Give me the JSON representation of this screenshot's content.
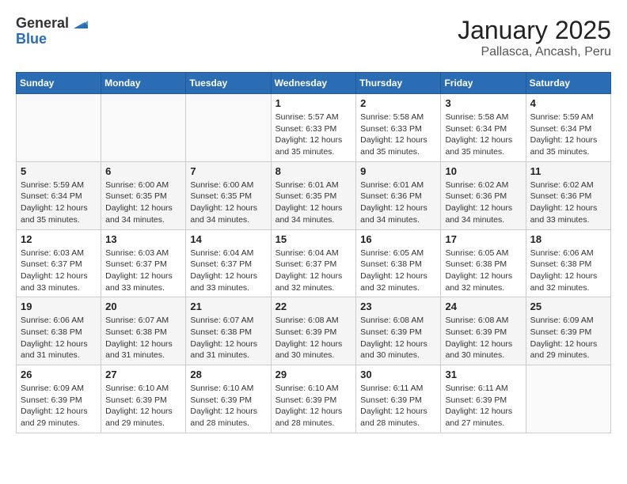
{
  "header": {
    "logo_general": "General",
    "logo_blue": "Blue",
    "month_title": "January 2025",
    "location": "Pallasca, Ancash, Peru"
  },
  "weekdays": [
    "Sunday",
    "Monday",
    "Tuesday",
    "Wednesday",
    "Thursday",
    "Friday",
    "Saturday"
  ],
  "weeks": [
    [
      {
        "day": "",
        "info": ""
      },
      {
        "day": "",
        "info": ""
      },
      {
        "day": "",
        "info": ""
      },
      {
        "day": "1",
        "info": "Sunrise: 5:57 AM\nSunset: 6:33 PM\nDaylight: 12 hours and 35 minutes."
      },
      {
        "day": "2",
        "info": "Sunrise: 5:58 AM\nSunset: 6:33 PM\nDaylight: 12 hours and 35 minutes."
      },
      {
        "day": "3",
        "info": "Sunrise: 5:58 AM\nSunset: 6:34 PM\nDaylight: 12 hours and 35 minutes."
      },
      {
        "day": "4",
        "info": "Sunrise: 5:59 AM\nSunset: 6:34 PM\nDaylight: 12 hours and 35 minutes."
      }
    ],
    [
      {
        "day": "5",
        "info": "Sunrise: 5:59 AM\nSunset: 6:34 PM\nDaylight: 12 hours and 35 minutes."
      },
      {
        "day": "6",
        "info": "Sunrise: 6:00 AM\nSunset: 6:35 PM\nDaylight: 12 hours and 34 minutes."
      },
      {
        "day": "7",
        "info": "Sunrise: 6:00 AM\nSunset: 6:35 PM\nDaylight: 12 hours and 34 minutes."
      },
      {
        "day": "8",
        "info": "Sunrise: 6:01 AM\nSunset: 6:35 PM\nDaylight: 12 hours and 34 minutes."
      },
      {
        "day": "9",
        "info": "Sunrise: 6:01 AM\nSunset: 6:36 PM\nDaylight: 12 hours and 34 minutes."
      },
      {
        "day": "10",
        "info": "Sunrise: 6:02 AM\nSunset: 6:36 PM\nDaylight: 12 hours and 34 minutes."
      },
      {
        "day": "11",
        "info": "Sunrise: 6:02 AM\nSunset: 6:36 PM\nDaylight: 12 hours and 33 minutes."
      }
    ],
    [
      {
        "day": "12",
        "info": "Sunrise: 6:03 AM\nSunset: 6:37 PM\nDaylight: 12 hours and 33 minutes."
      },
      {
        "day": "13",
        "info": "Sunrise: 6:03 AM\nSunset: 6:37 PM\nDaylight: 12 hours and 33 minutes."
      },
      {
        "day": "14",
        "info": "Sunrise: 6:04 AM\nSunset: 6:37 PM\nDaylight: 12 hours and 33 minutes."
      },
      {
        "day": "15",
        "info": "Sunrise: 6:04 AM\nSunset: 6:37 PM\nDaylight: 12 hours and 32 minutes."
      },
      {
        "day": "16",
        "info": "Sunrise: 6:05 AM\nSunset: 6:38 PM\nDaylight: 12 hours and 32 minutes."
      },
      {
        "day": "17",
        "info": "Sunrise: 6:05 AM\nSunset: 6:38 PM\nDaylight: 12 hours and 32 minutes."
      },
      {
        "day": "18",
        "info": "Sunrise: 6:06 AM\nSunset: 6:38 PM\nDaylight: 12 hours and 32 minutes."
      }
    ],
    [
      {
        "day": "19",
        "info": "Sunrise: 6:06 AM\nSunset: 6:38 PM\nDaylight: 12 hours and 31 minutes."
      },
      {
        "day": "20",
        "info": "Sunrise: 6:07 AM\nSunset: 6:38 PM\nDaylight: 12 hours and 31 minutes."
      },
      {
        "day": "21",
        "info": "Sunrise: 6:07 AM\nSunset: 6:38 PM\nDaylight: 12 hours and 31 minutes."
      },
      {
        "day": "22",
        "info": "Sunrise: 6:08 AM\nSunset: 6:39 PM\nDaylight: 12 hours and 30 minutes."
      },
      {
        "day": "23",
        "info": "Sunrise: 6:08 AM\nSunset: 6:39 PM\nDaylight: 12 hours and 30 minutes."
      },
      {
        "day": "24",
        "info": "Sunrise: 6:08 AM\nSunset: 6:39 PM\nDaylight: 12 hours and 30 minutes."
      },
      {
        "day": "25",
        "info": "Sunrise: 6:09 AM\nSunset: 6:39 PM\nDaylight: 12 hours and 29 minutes."
      }
    ],
    [
      {
        "day": "26",
        "info": "Sunrise: 6:09 AM\nSunset: 6:39 PM\nDaylight: 12 hours and 29 minutes."
      },
      {
        "day": "27",
        "info": "Sunrise: 6:10 AM\nSunset: 6:39 PM\nDaylight: 12 hours and 29 minutes."
      },
      {
        "day": "28",
        "info": "Sunrise: 6:10 AM\nSunset: 6:39 PM\nDaylight: 12 hours and 28 minutes."
      },
      {
        "day": "29",
        "info": "Sunrise: 6:10 AM\nSunset: 6:39 PM\nDaylight: 12 hours and 28 minutes."
      },
      {
        "day": "30",
        "info": "Sunrise: 6:11 AM\nSunset: 6:39 PM\nDaylight: 12 hours and 28 minutes."
      },
      {
        "day": "31",
        "info": "Sunrise: 6:11 AM\nSunset: 6:39 PM\nDaylight: 12 hours and 27 minutes."
      },
      {
        "day": "",
        "info": ""
      }
    ]
  ]
}
